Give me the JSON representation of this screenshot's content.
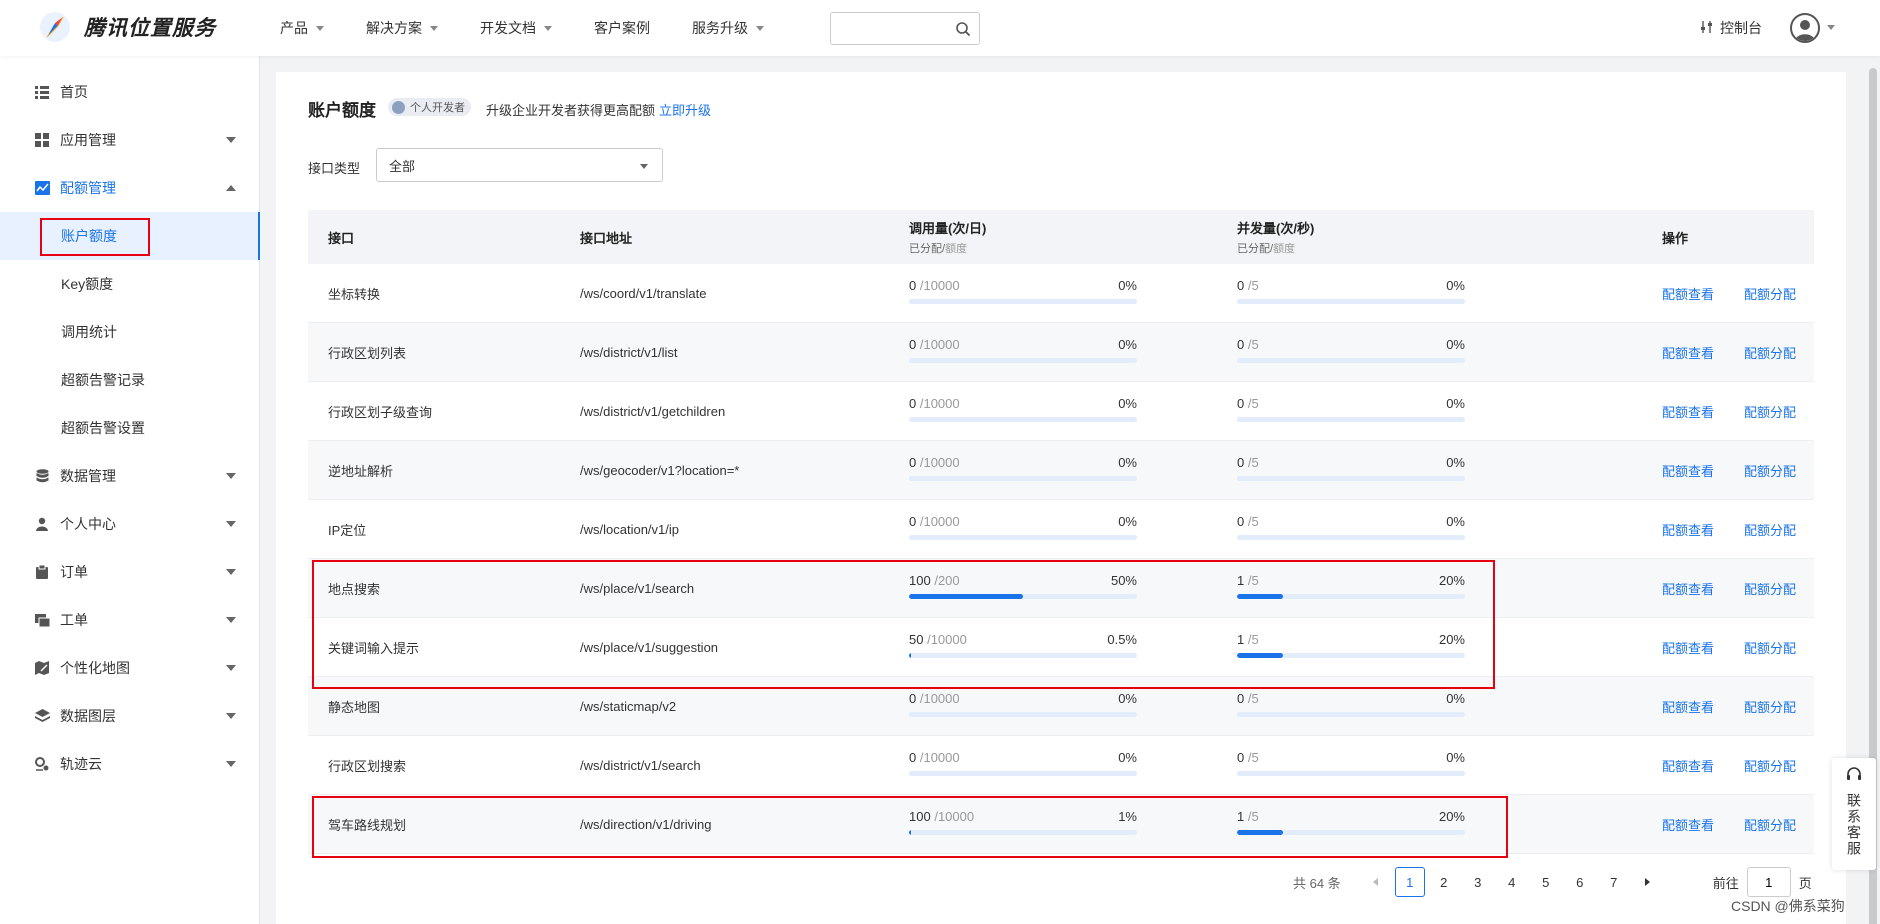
{
  "brand": {
    "name": "腾讯位置服务"
  },
  "nav": [
    {
      "label": "产品",
      "has_dropdown": true
    },
    {
      "label": "解决方案",
      "has_dropdown": true
    },
    {
      "label": "开发文档",
      "has_dropdown": true
    },
    {
      "label": "客户案例",
      "has_dropdown": false
    },
    {
      "label": "服务升级",
      "has_dropdown": true
    }
  ],
  "search": {
    "placeholder": ""
  },
  "header_right": {
    "console_label": "控制台"
  },
  "sidebar": {
    "items": [
      {
        "label": "首页",
        "icon": "list-icon"
      },
      {
        "label": "应用管理",
        "icon": "grid-icon"
      },
      {
        "label": "配额管理",
        "icon": "chart-icon"
      },
      {
        "label": "账户额度",
        "sub": true,
        "active": true
      },
      {
        "label": "Key额度",
        "sub": true
      },
      {
        "label": "调用统计",
        "sub": true
      },
      {
        "label": "超额告警记录",
        "sub": true
      },
      {
        "label": "超额告警设置",
        "sub": true
      },
      {
        "label": "数据管理",
        "icon": "database-icon"
      },
      {
        "label": "个人中心",
        "icon": "person-icon"
      },
      {
        "label": "订单",
        "icon": "clipboard-icon"
      },
      {
        "label": "工单",
        "icon": "ticket-icon"
      },
      {
        "label": "个性化地图",
        "icon": "map-edit-icon"
      },
      {
        "label": "数据图层",
        "icon": "layers-icon"
      },
      {
        "label": "轨迹云",
        "icon": "track-icon"
      }
    ]
  },
  "page": {
    "title": "账户额度",
    "badge": "个人开发者",
    "upgrade_tip": "升级企业开发者获得更高配额",
    "upgrade_link": "立即升级",
    "filter_label": "接口类型",
    "filter_value": "全部"
  },
  "table": {
    "headers": {
      "api": "接口",
      "url": "接口地址",
      "calls": "调用量(次/日)",
      "calls_sub_a": "已分配/",
      "calls_sub_b": "额度",
      "concurrency": "并发量(次/秒)",
      "conc_sub_a": "已分配/",
      "conc_sub_b": "额度",
      "ops": "操作"
    },
    "op_view": "配额查看",
    "op_assign": "配额分配",
    "rows": [
      {
        "name": "坐标转换",
        "url": "/ws/coord/v1/translate",
        "calls_used": "0",
        "calls_limit": "/10000",
        "calls_pct": "0%",
        "calls_fill": 0,
        "conc_used": "0",
        "conc_limit": "/5",
        "conc_pct": "0%",
        "conc_fill": 0
      },
      {
        "name": "行政区划列表",
        "url": "/ws/district/v1/list",
        "calls_used": "0",
        "calls_limit": "/10000",
        "calls_pct": "0%",
        "calls_fill": 0,
        "conc_used": "0",
        "conc_limit": "/5",
        "conc_pct": "0%",
        "conc_fill": 0
      },
      {
        "name": "行政区划子级查询",
        "url": "/ws/district/v1/getchildren",
        "calls_used": "0",
        "calls_limit": "/10000",
        "calls_pct": "0%",
        "calls_fill": 0,
        "conc_used": "0",
        "conc_limit": "/5",
        "conc_pct": "0%",
        "conc_fill": 0
      },
      {
        "name": "逆地址解析",
        "url": "/ws/geocoder/v1?location=*",
        "calls_used": "0",
        "calls_limit": "/10000",
        "calls_pct": "0%",
        "calls_fill": 0,
        "conc_used": "0",
        "conc_limit": "/5",
        "conc_pct": "0%",
        "conc_fill": 0
      },
      {
        "name": "IP定位",
        "url": "/ws/location/v1/ip",
        "calls_used": "0",
        "calls_limit": "/10000",
        "calls_pct": "0%",
        "calls_fill": 0,
        "conc_used": "0",
        "conc_limit": "/5",
        "conc_pct": "0%",
        "conc_fill": 0
      },
      {
        "name": "地点搜索",
        "url": "/ws/place/v1/search",
        "calls_used": "100",
        "calls_limit": "/200",
        "calls_pct": "50%",
        "calls_fill": 0.5,
        "conc_used": "1",
        "conc_limit": "/5",
        "conc_pct": "20%",
        "conc_fill": 0.2
      },
      {
        "name": "关键词输入提示",
        "url": "/ws/place/v1/suggestion",
        "calls_used": "50",
        "calls_limit": "/10000",
        "calls_pct": "0.5%",
        "calls_fill": 0.005,
        "conc_used": "1",
        "conc_limit": "/5",
        "conc_pct": "20%",
        "conc_fill": 0.2
      },
      {
        "name": "静态地图",
        "url": "/ws/staticmap/v2",
        "calls_used": "0",
        "calls_limit": "/10000",
        "calls_pct": "0%",
        "calls_fill": 0,
        "conc_used": "0",
        "conc_limit": "/5",
        "conc_pct": "0%",
        "conc_fill": 0
      },
      {
        "name": "行政区划搜索",
        "url": "/ws/district/v1/search",
        "calls_used": "0",
        "calls_limit": "/10000",
        "calls_pct": "0%",
        "calls_fill": 0,
        "conc_used": "0",
        "conc_limit": "/5",
        "conc_pct": "0%",
        "conc_fill": 0
      },
      {
        "name": "驾车路线规划",
        "url": "/ws/direction/v1/driving",
        "calls_used": "100",
        "calls_limit": "/10000",
        "calls_pct": "1%",
        "calls_fill": 0.01,
        "conc_used": "1",
        "conc_limit": "/5",
        "conc_pct": "20%",
        "conc_fill": 0.2
      }
    ]
  },
  "pagination": {
    "total": "共 64 条",
    "pages": [
      "1",
      "2",
      "3",
      "4",
      "5",
      "6",
      "7"
    ],
    "current": "1",
    "goto_label": "前往",
    "goto_value": "1",
    "page_suffix": "页"
  },
  "float": {
    "service_label": "联系客服"
  },
  "watermark": "CSDN @佛系菜狗",
  "colors": {
    "accent": "#1a73e8",
    "annotation": "#e60012"
  }
}
